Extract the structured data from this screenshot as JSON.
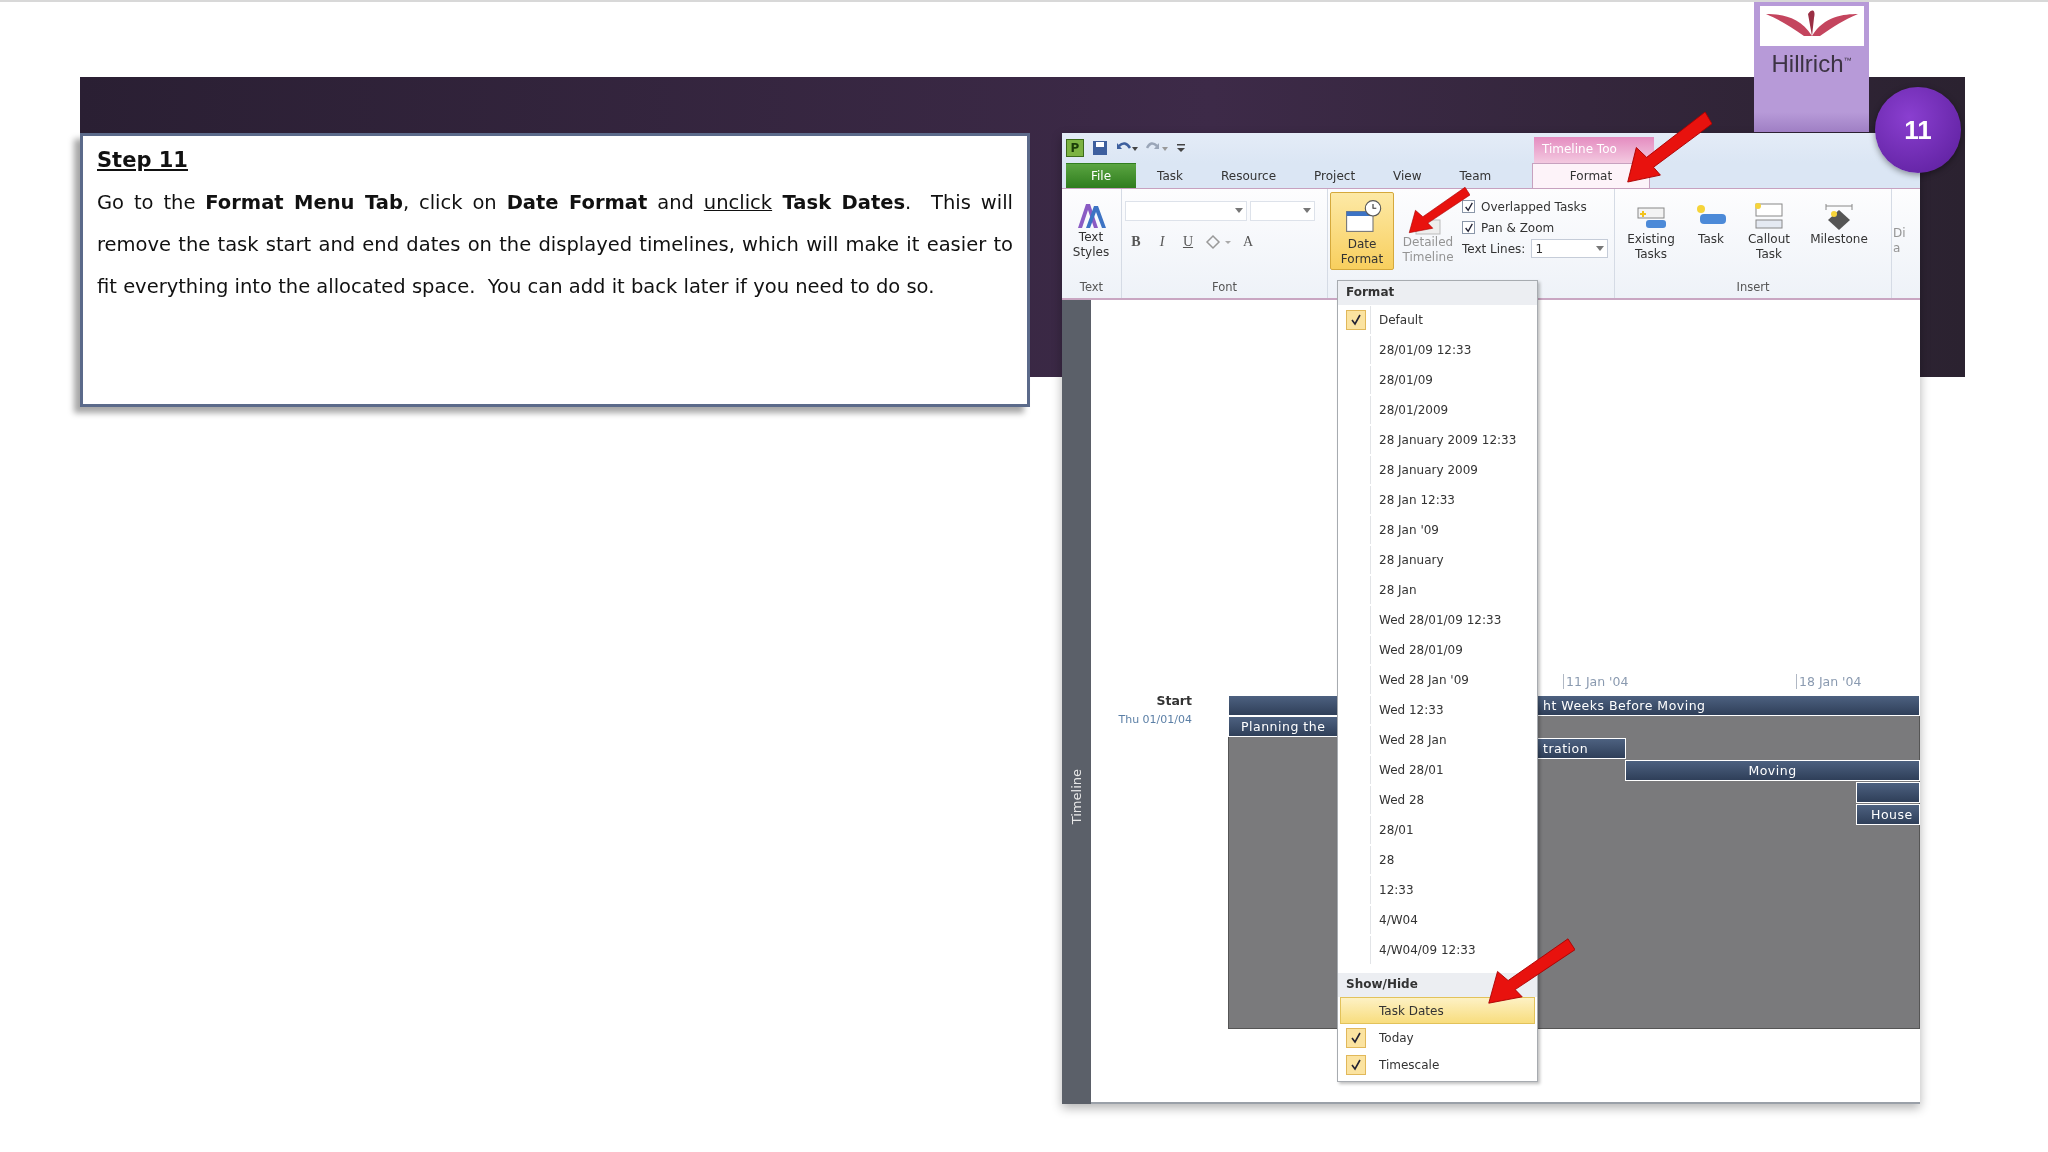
{
  "logo": {
    "name": "Hillrich",
    "mark": "™"
  },
  "slide_number": "11",
  "instruction": {
    "heading": "Step 11",
    "paragraph": [
      {
        "kind": "plain",
        "text": "Go to the "
      },
      {
        "kind": "bold",
        "text": "Format Menu Tab"
      },
      {
        "kind": "plain",
        "text": ", click on "
      },
      {
        "kind": "bold",
        "text": "Date Format"
      },
      {
        "kind": "plain",
        "text": " and "
      },
      {
        "kind": "underline",
        "text": "unclick"
      },
      {
        "kind": "bold",
        "text": " Task Dates"
      },
      {
        "kind": "plain",
        "text": ".  This will remove the task start and end dates on the displayed timelines, which will make it easier to fit everything into the allocated space.  You can add it back later if you need to do so."
      }
    ]
  },
  "app": {
    "quick_access": {
      "app_letter": "P"
    },
    "context_tab": "Timeline Too",
    "tabs": [
      {
        "label": "File",
        "kind": "file",
        "selected": false
      },
      {
        "label": "Task",
        "kind": "tab",
        "selected": false
      },
      {
        "label": "Resource",
        "kind": "tab",
        "selected": false
      },
      {
        "label": "Project",
        "kind": "tab",
        "selected": false
      },
      {
        "label": "View",
        "kind": "tab",
        "selected": false
      },
      {
        "label": "Team",
        "kind": "tab",
        "selected": false
      },
      {
        "label": "Format",
        "kind": "context",
        "selected": true
      }
    ],
    "ribbon": {
      "text_group": {
        "button": "Text Styles",
        "label": "Text"
      },
      "font_group": {
        "label": "Font",
        "format_buttons": [
          "B",
          "I",
          "U"
        ],
        "color_button": "A"
      },
      "date_format": {
        "label": "Date Format",
        "selected": true
      },
      "detailed_timeline": {
        "label": "Detailed Timeline",
        "disabled": true
      },
      "options": [
        {
          "label": "Overlapped Tasks",
          "checked": true
        },
        {
          "label": "Pan & Zoom",
          "checked": true
        }
      ],
      "text_lines": {
        "label": "Text Lines:",
        "value": "1"
      },
      "insert_group": {
        "label": "Insert",
        "buttons": [
          "Existing Tasks",
          "Task",
          "Callout Task",
          "Milestone"
        ]
      },
      "cut_button": {
        "lines": [
          "Di",
          "a"
        ]
      }
    },
    "menu": {
      "sections": [
        {
          "title": "Format",
          "items": [
            {
              "label": "Default",
              "checked": true,
              "highlighted": false
            },
            {
              "label": "28/01/09 12:33",
              "checked": false,
              "highlighted": false
            },
            {
              "label": "28/01/09",
              "checked": false,
              "highlighted": false
            },
            {
              "label": "28/01/2009",
              "checked": false,
              "highlighted": false
            },
            {
              "label": "28 January 2009 12:33",
              "checked": false,
              "highlighted": false
            },
            {
              "label": "28 January 2009",
              "checked": false,
              "highlighted": false
            },
            {
              "label": "28 Jan 12:33",
              "checked": false,
              "highlighted": false
            },
            {
              "label": "28 Jan '09",
              "checked": false,
              "highlighted": false
            },
            {
              "label": "28 January",
              "checked": false,
              "highlighted": false
            },
            {
              "label": "28 Jan",
              "checked": false,
              "highlighted": false
            },
            {
              "label": "Wed 28/01/09 12:33",
              "checked": false,
              "highlighted": false
            },
            {
              "label": "Wed 28/01/09",
              "checked": false,
              "highlighted": false
            },
            {
              "label": "Wed 28 Jan '09",
              "checked": false,
              "highlighted": false
            },
            {
              "label": "Wed 12:33",
              "checked": false,
              "highlighted": false
            },
            {
              "label": "Wed 28 Jan",
              "checked": false,
              "highlighted": false
            },
            {
              "label": "Wed 28/01",
              "checked": false,
              "highlighted": false
            },
            {
              "label": "Wed 28",
              "checked": false,
              "highlighted": false
            },
            {
              "label": "28/01",
              "checked": false,
              "highlighted": false
            },
            {
              "label": "28",
              "checked": false,
              "highlighted": false
            },
            {
              "label": "12:33",
              "checked": false,
              "highlighted": false
            },
            {
              "label": "4/W04",
              "checked": false,
              "highlighted": false
            },
            {
              "label": "4/W04/09 12:33",
              "checked": false,
              "highlighted": false
            }
          ]
        },
        {
          "title": "Show/Hide",
          "items": [
            {
              "label": "Task Dates",
              "checked": false,
              "highlighted": true
            },
            {
              "label": "Today",
              "checked": true,
              "highlighted": false
            },
            {
              "label": "Timescale",
              "checked": true,
              "highlighted": false
            }
          ]
        }
      ]
    },
    "timeline": {
      "side_label": "Timeline",
      "start": {
        "label": "Start",
        "date": "Thu 01/01/04"
      },
      "ticks": [
        "11 Jan '04",
        "18 Jan '04"
      ],
      "bars": [
        {
          "kind": "labeled",
          "label": "ht Weeks Before Moving"
        },
        {
          "kind": "labeled",
          "label": "Planning the"
        },
        {
          "kind": "labeled",
          "label": "tration"
        },
        {
          "kind": "labeled",
          "label": "Moving"
        },
        {
          "kind": "blank"
        },
        {
          "kind": "labeled",
          "label": "House"
        }
      ]
    }
  }
}
